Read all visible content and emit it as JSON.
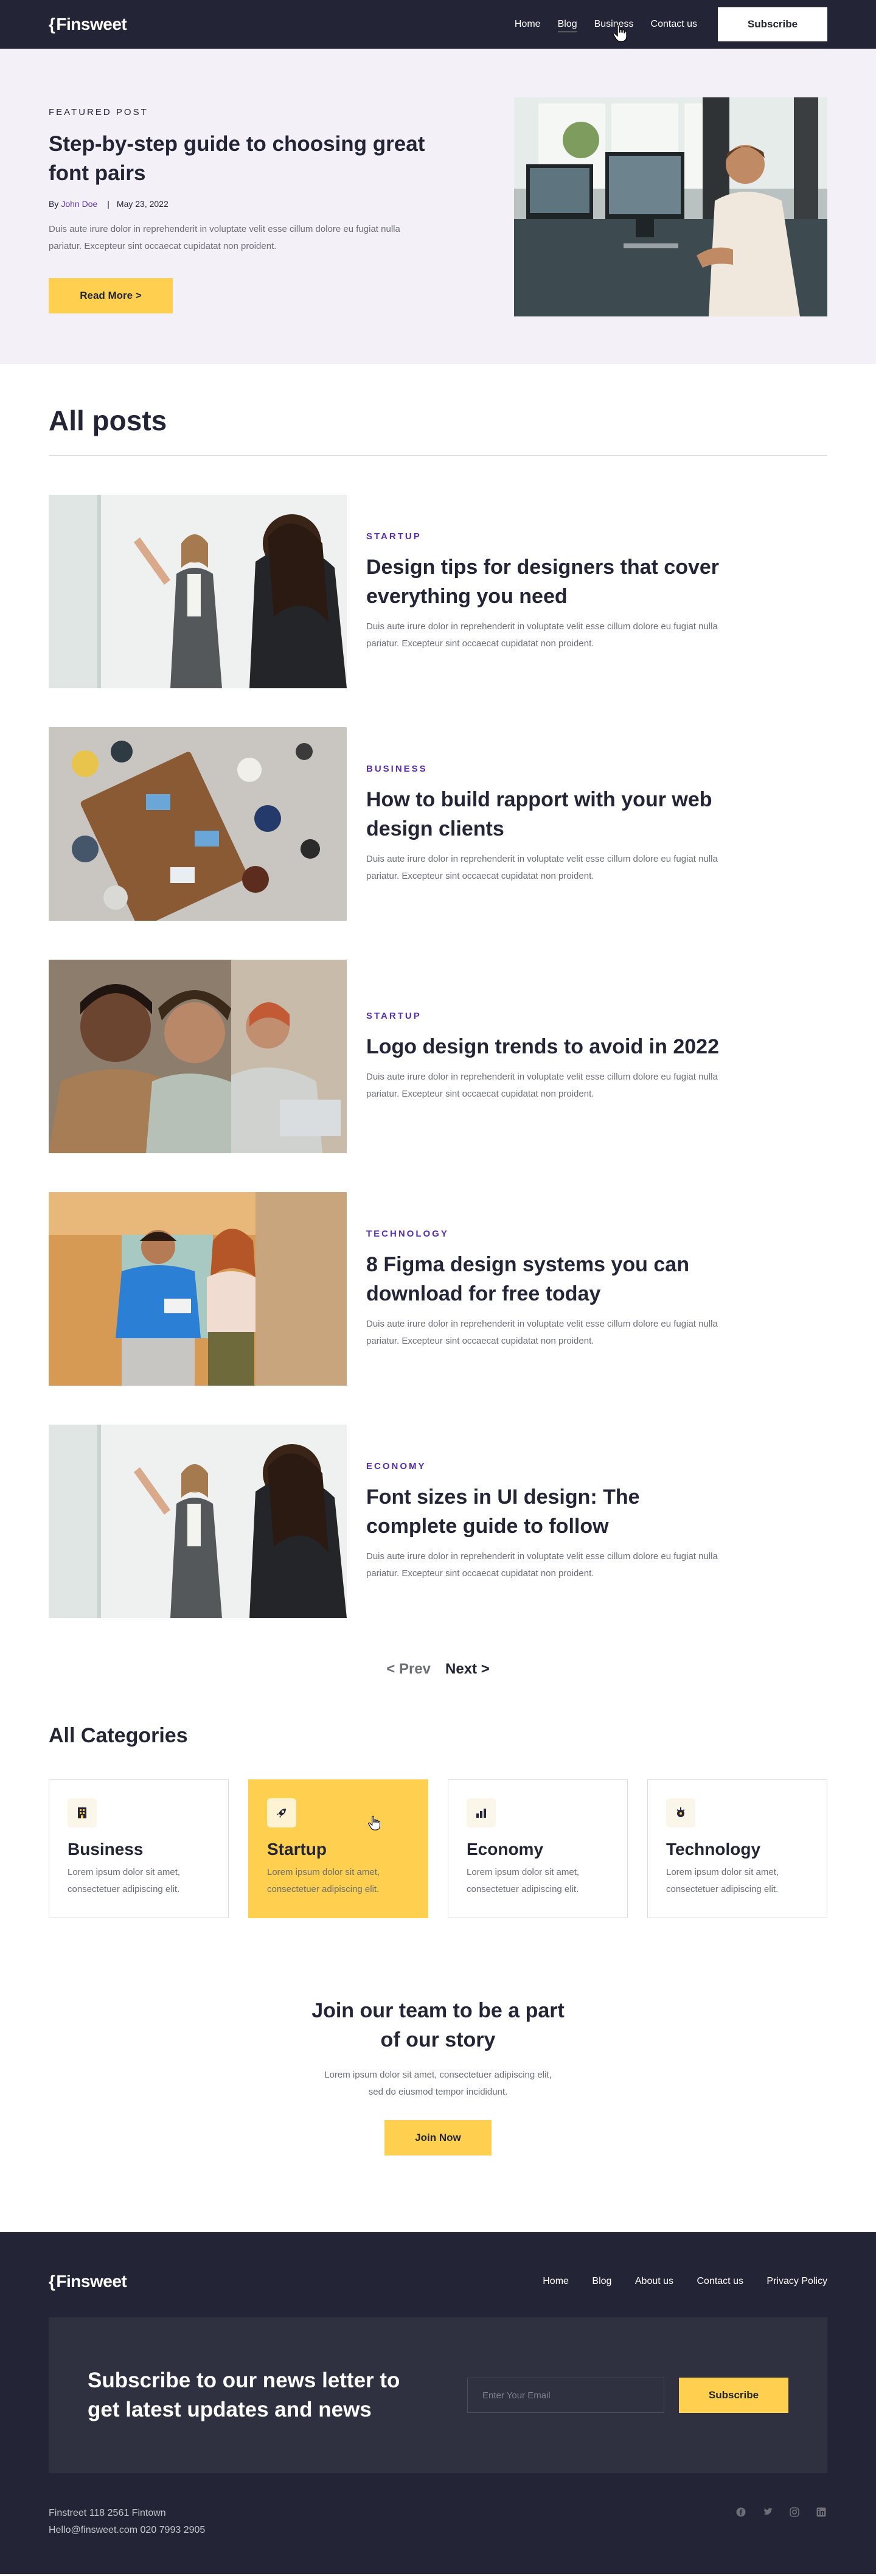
{
  "header": {
    "logo": "Finsweet",
    "nav": [
      "Home",
      "Blog",
      "Business",
      "Contact us"
    ],
    "subscribe_label": "Subscribe"
  },
  "featured": {
    "eyebrow": "FEATURED POST",
    "title": "Step-by-step guide to choosing great font pairs",
    "by": "By",
    "author": "John Doe",
    "sep": "|",
    "date": "May 23, 2022",
    "excerpt": "Duis aute irure dolor in reprehenderit in voluptate velit esse cillum dolore eu fugiat nulla pariatur. Excepteur sint occaecat cupidatat non proident.",
    "cta": "Read More >"
  },
  "posts": {
    "title": "All posts",
    "items": [
      {
        "category": "STARTUP",
        "title": "Design tips for designers that cover everything you need",
        "excerpt": "Duis aute irure dolor in reprehenderit in voluptate velit esse cillum dolore eu fugiat nulla pariatur. Excepteur sint occaecat cupidatat non proident."
      },
      {
        "category": "BUSINESS",
        "title": "How to build rapport with your web design clients",
        "excerpt": "Duis aute irure dolor in reprehenderit in voluptate velit esse cillum dolore eu fugiat nulla pariatur. Excepteur sint occaecat cupidatat non proident."
      },
      {
        "category": "STARTUP",
        "title": "Logo design trends to avoid in 2022",
        "excerpt": "Duis aute irure dolor in reprehenderit in voluptate velit esse cillum dolore eu fugiat nulla pariatur. Excepteur sint occaecat cupidatat non proident."
      },
      {
        "category": "TECHNOLOGY",
        "title": "8 Figma design systems you can download for free today",
        "excerpt": "Duis aute irure dolor in reprehenderit in voluptate velit esse cillum dolore eu fugiat nulla pariatur. Excepteur sint occaecat cupidatat non proident."
      },
      {
        "category": "ECONOMY",
        "title": "Font sizes in UI design: The complete guide to follow",
        "excerpt": "Duis aute irure dolor in reprehenderit in voluptate velit esse cillum dolore eu fugiat nulla pariatur. Excepteur sint occaecat cupidatat non proident."
      }
    ]
  },
  "pager": {
    "prev": "< Prev",
    "next": "Next >"
  },
  "categories": {
    "title": "All Categories",
    "items": [
      {
        "name": "Business",
        "desc": "Lorem ipsum dolor sit amet, consectetuer adipiscing elit.",
        "icon": "building-icon"
      },
      {
        "name": "Startup",
        "desc": "Lorem ipsum dolor sit amet, consectetuer adipiscing elit.",
        "icon": "rocket-icon"
      },
      {
        "name": "Economy",
        "desc": "Lorem ipsum dolor sit amet, consectetuer adipiscing elit.",
        "icon": "bar-chart-icon"
      },
      {
        "name": "Technology",
        "desc": "Lorem ipsum dolor sit amet, consectetuer adipiscing elit.",
        "icon": "chip-icon"
      }
    ]
  },
  "join": {
    "title": "Join our team to be a part of our story",
    "text": "Lorem ipsum dolor sit amet, consectetuer adipiscing elit, sed do eiusmod tempor incididunt.",
    "cta": "Join Now"
  },
  "footer": {
    "logo": "Finsweet",
    "nav": [
      "Home",
      "Blog",
      "About us",
      "Contact us",
      "Privacy Policy"
    ],
    "newsletter_title": "Subscribe to our news letter to get latest updates and news",
    "email_placeholder": "Enter Your Email",
    "subscribe_label": "Subscribe",
    "address": "Finstreet 118 2561 Fintown",
    "contact": "Hello@finsweet.com  020 7993 2905",
    "socials": [
      "facebook-icon",
      "twitter-icon",
      "instagram-icon",
      "linkedin-icon"
    ]
  },
  "colors": {
    "dark": "#232536",
    "accent": "#FFD050",
    "purple": "#592EA9",
    "hero_bg": "#F4F0F8"
  }
}
